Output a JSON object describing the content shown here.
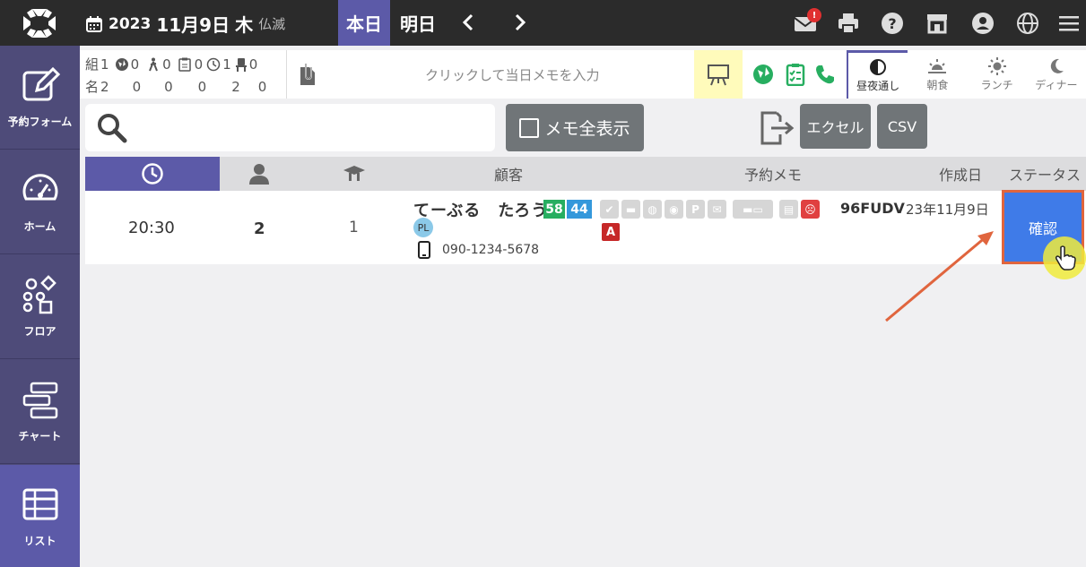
{
  "header": {
    "year": "2023",
    "date": "11月9日",
    "weekday": "木",
    "rokuyo": "仏滅",
    "today_label": "本日",
    "tomorrow_label": "明日",
    "mail_badge": "!"
  },
  "sidenav": {
    "items": [
      {
        "label": "予約フォーム"
      },
      {
        "label": "ホーム"
      },
      {
        "label": "フロア"
      },
      {
        "label": "チャート"
      },
      {
        "label": "リスト"
      }
    ]
  },
  "stats": {
    "row1_label": "組",
    "row2_label": "名",
    "row1": [
      "1",
      "0",
      "0",
      "0",
      "1",
      "0"
    ],
    "row2": [
      "2",
      "0",
      "0",
      "0",
      "2",
      "0"
    ]
  },
  "memo": {
    "placeholder": "クリックして当日メモを入力"
  },
  "meal_tabs": [
    {
      "label": "昼夜通し",
      "icon": "half-circle-icon"
    },
    {
      "label": "朝食",
      "icon": "sunrise-icon"
    },
    {
      "label": "ランチ",
      "icon": "sun-icon"
    },
    {
      "label": "ディナー",
      "icon": "moon-icon"
    }
  ],
  "toolbar": {
    "memo_all_label": "メモ全表示",
    "excel_label": "エクセル",
    "csv_label": "CSV"
  },
  "table": {
    "headers": {
      "customer": "顧客",
      "memo": "予約メモ",
      "created": "作成日",
      "status": "ステータス"
    },
    "row": {
      "time": "20:30",
      "people": "2",
      "tables": "1",
      "name": "てーぶる　たろう",
      "visit_a": "58",
      "visit_b": "44",
      "pl_badge": "PL",
      "phone": "090-1234-5678",
      "a_badge": "A",
      "code": "96FUDV",
      "created": "23年11月9日",
      "status": "確認"
    }
  },
  "colors": {
    "topbar": "#2b2b2b",
    "accent": "#5c5aa8",
    "sidenav": "#4e4b79",
    "status_button": "#3f7be8",
    "annotation": "#e0653e"
  }
}
